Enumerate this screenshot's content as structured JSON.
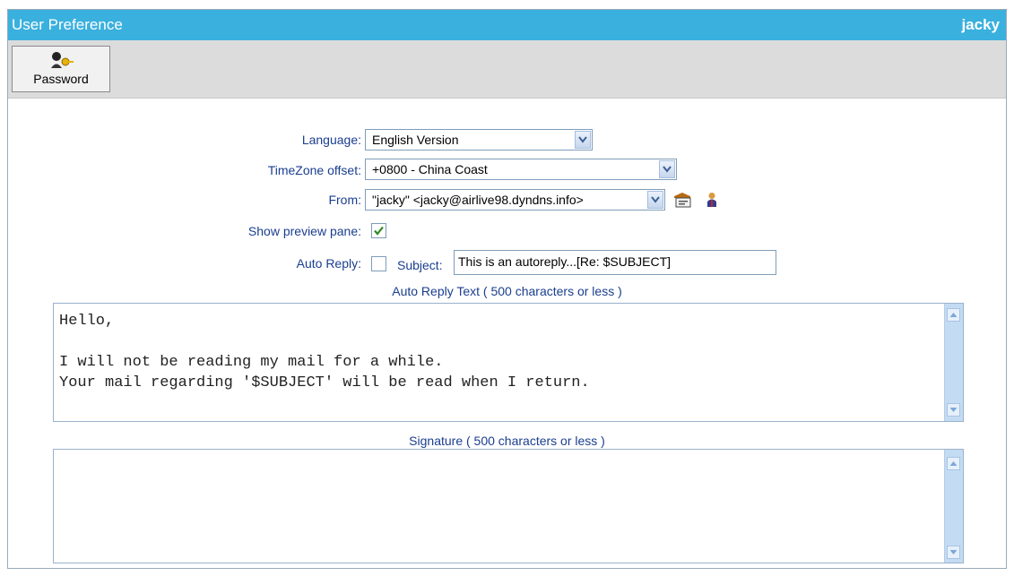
{
  "window": {
    "title": "User Preference",
    "user": "jacky"
  },
  "toolbar": {
    "password_label": "Password",
    "password_icon": "key-person-icon"
  },
  "form": {
    "language": {
      "label": "Language:",
      "value": "English Version"
    },
    "timezone": {
      "label": "TimeZone offset:",
      "value": "+0800 - China Coast"
    },
    "from": {
      "label": "From:",
      "value": "\"jacky\" <jacky@airlive98.dyndns.info>",
      "icons": [
        "address-card-icon",
        "person-icon"
      ]
    },
    "preview": {
      "label": "Show preview pane:",
      "checked": true
    },
    "autoreply": {
      "label": "Auto Reply:",
      "checked": false,
      "subject_label": "Subject:",
      "subject_value": "This is an autoreply...[Re: $SUBJECT]"
    },
    "autoreply_text": {
      "caption": "Auto Reply Text ( 500 characters or less )",
      "value": "Hello,\n\nI will not be reading my mail for a while.\nYour mail regarding '$SUBJECT' will be read when I return."
    },
    "signature": {
      "caption": "Signature ( 500 characters or less )",
      "value": ""
    }
  },
  "colors": {
    "titlebar": "#3ab0de",
    "label": "#1a3e8f",
    "toolbar": "#dcdcdc"
  }
}
